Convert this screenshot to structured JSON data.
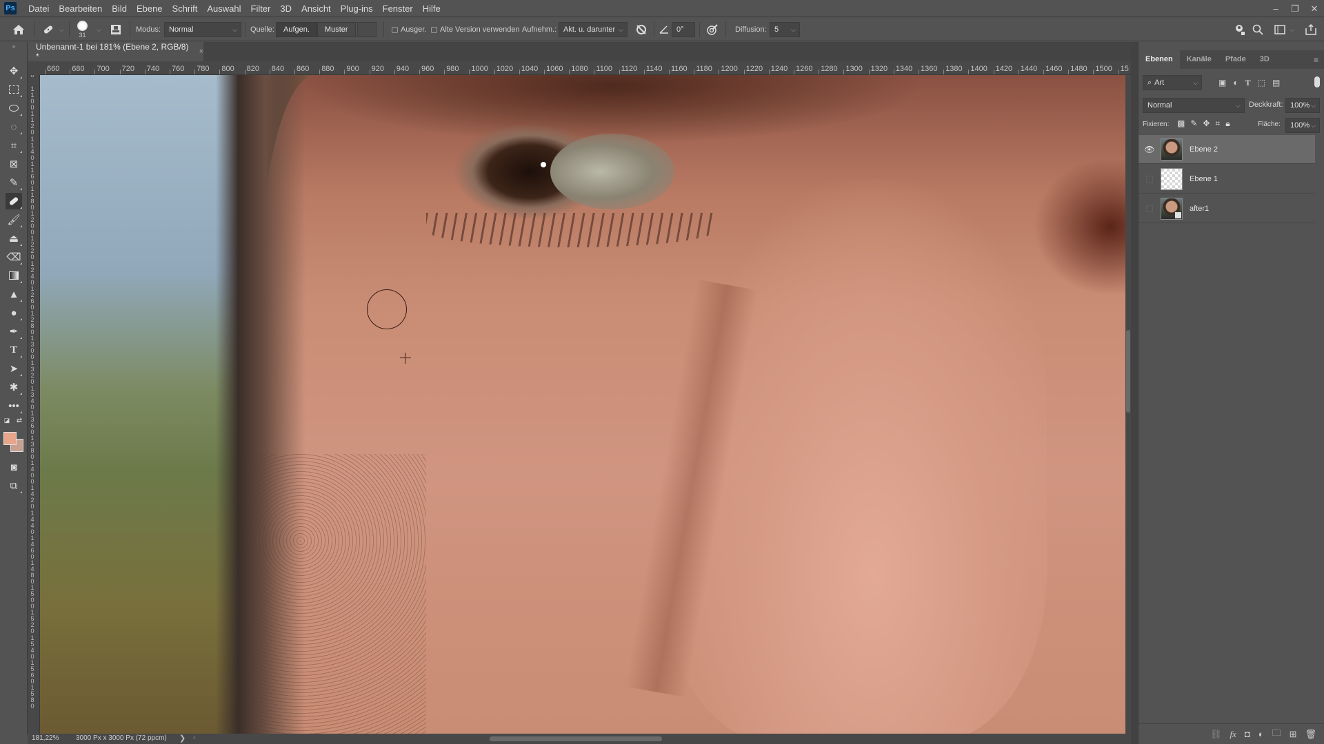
{
  "app": {
    "logo": "Ps",
    "menu": [
      "Datei",
      "Bearbeiten",
      "Bild",
      "Ebene",
      "Schrift",
      "Auswahl",
      "Filter",
      "3D",
      "Ansicht",
      "Plug-ins",
      "Fenster",
      "Hilfe"
    ],
    "window_controls": {
      "minimize": "–",
      "restore": "❐",
      "close": "✕"
    }
  },
  "options_bar": {
    "tool_icon": "healing-brush-icon",
    "brush_size": "31",
    "mode_label": "Modus:",
    "mode_value": "Normal",
    "source_label": "Quelle:",
    "source_sampled": "Aufgen.",
    "source_pattern": "Muster",
    "aligned_label": "Ausger.",
    "aligned_checked": false,
    "legacy_label": "Alte Version verwenden",
    "legacy_checked": false,
    "sample_label": "Aufnehm.:",
    "sample_value": "Akt. u. darunter",
    "angle_value": "0°",
    "diffusion_label": "Diffusion:",
    "diffusion_value": "5"
  },
  "document": {
    "tab_title": "Unbenannt-1 bei 181% (Ebene 2, RGB/8) *",
    "close": "×"
  },
  "ruler": {
    "horizontal": [
      "660",
      "680",
      "700",
      "720",
      "740",
      "760",
      "780",
      "800",
      "820",
      "840",
      "860",
      "880",
      "900",
      "920",
      "940",
      "960",
      "980",
      "1000",
      "1020",
      "1040",
      "1060",
      "1080",
      "1100",
      "1120",
      "1140",
      "1160",
      "1180",
      "1200",
      "1220",
      "1240",
      "1260",
      "1280",
      "1300",
      "1320",
      "1340",
      "1360",
      "1380",
      "1400",
      "1420",
      "1440",
      "1460",
      "1480",
      "1500",
      "15"
    ],
    "vertical": [
      "0",
      "1100",
      "1120",
      "1140",
      "1160",
      "1180",
      "1200",
      "1220",
      "1240",
      "1260",
      "1280",
      "1300",
      "1320",
      "1340",
      "1360",
      "1380",
      "1400",
      "1420",
      "1440",
      "1460",
      "1480",
      "1500",
      "1520",
      "1540",
      "1560",
      "1580"
    ]
  },
  "status": {
    "zoom": "181,22%",
    "doc_info": "3000 Px x 3000 Px (72 ppcm)",
    "arrow": "❯",
    "nav_left": "‹"
  },
  "colors": {
    "foreground": "#e8a58a",
    "background": "#c9a090"
  },
  "layers_panel": {
    "tabs": [
      "Ebenen",
      "Kanäle",
      "Pfade",
      "3D"
    ],
    "active_tab": 0,
    "filter_label": "Art",
    "blend_mode": "Normal",
    "opacity_label": "Deckkraft:",
    "opacity_value": "100%",
    "lock_label": "Fixieren:",
    "fill_label": "Fläche:",
    "fill_value": "100%",
    "layers": [
      {
        "name": "Ebene 2",
        "visible": true,
        "selected": true,
        "thumb": "photo"
      },
      {
        "name": "Ebene 1",
        "visible": false,
        "selected": false,
        "thumb": "transparent"
      },
      {
        "name": "after1",
        "visible": false,
        "selected": false,
        "thumb": "smart-object"
      }
    ]
  }
}
